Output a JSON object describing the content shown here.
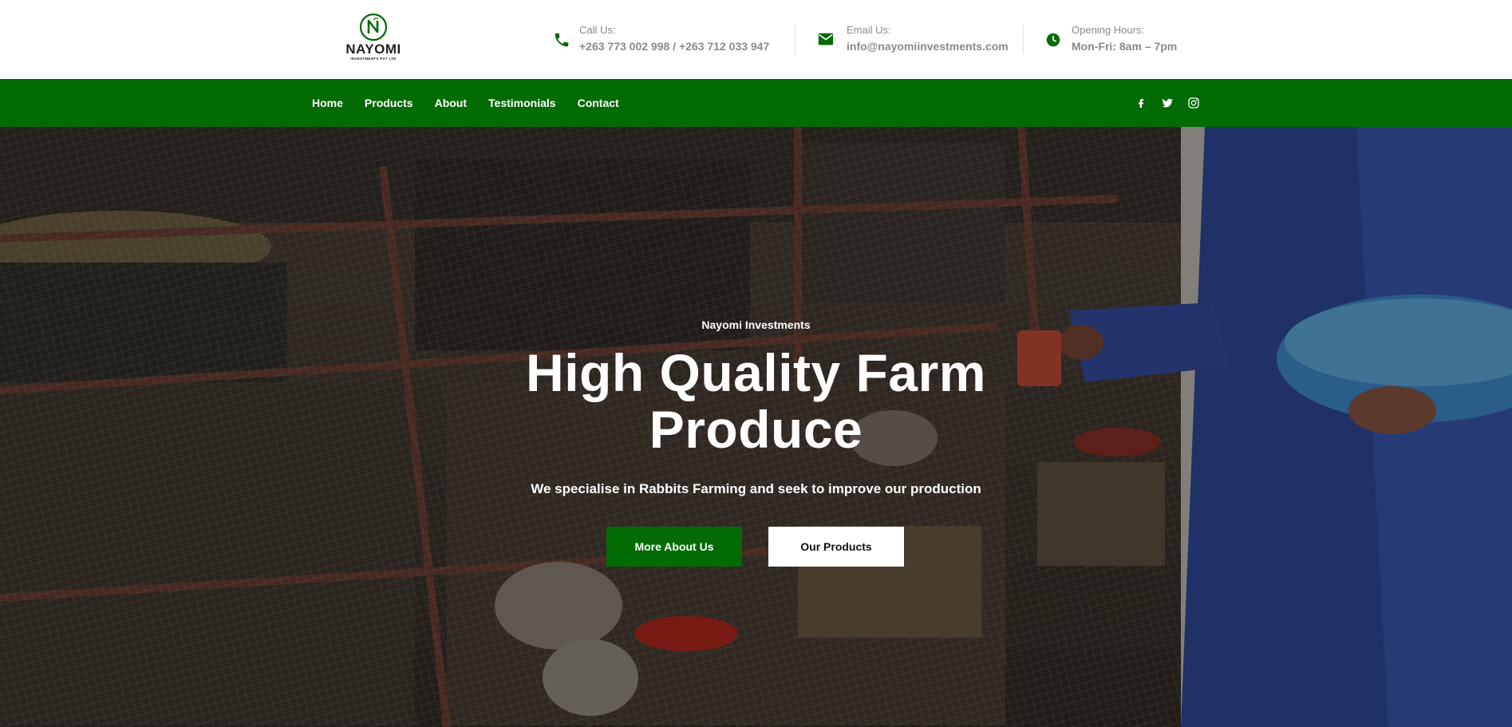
{
  "brand": {
    "name": "NAYOMI",
    "tagline": "INVESTMENTS PVT LTD",
    "color": "#026b04"
  },
  "contact": {
    "phone": {
      "label": "Call Us:",
      "value": "+263 773 002 998 / +263 712 033 947",
      "icon": "phone-icon"
    },
    "email": {
      "label": "Email Us:",
      "value": "info@nayomiinvestments.com",
      "icon": "mail-icon"
    },
    "hours": {
      "label": "Opening Hours:",
      "value": "Mon-Fri: 8am – 7pm",
      "icon": "clock-icon"
    }
  },
  "nav": {
    "items": [
      {
        "label": "Home"
      },
      {
        "label": "Products"
      },
      {
        "label": "About"
      },
      {
        "label": "Testimonials"
      },
      {
        "label": "Contact"
      }
    ],
    "socials": [
      "facebook-icon",
      "twitter-icon",
      "instagram-icon"
    ]
  },
  "hero": {
    "eyebrow": "Nayomi Investments",
    "headline": "High Quality Farm Produce",
    "subline": "We specialise in Rabbits Farming and seek to improve our production",
    "primary_button": "More About Us",
    "secondary_button": "Our Products"
  }
}
